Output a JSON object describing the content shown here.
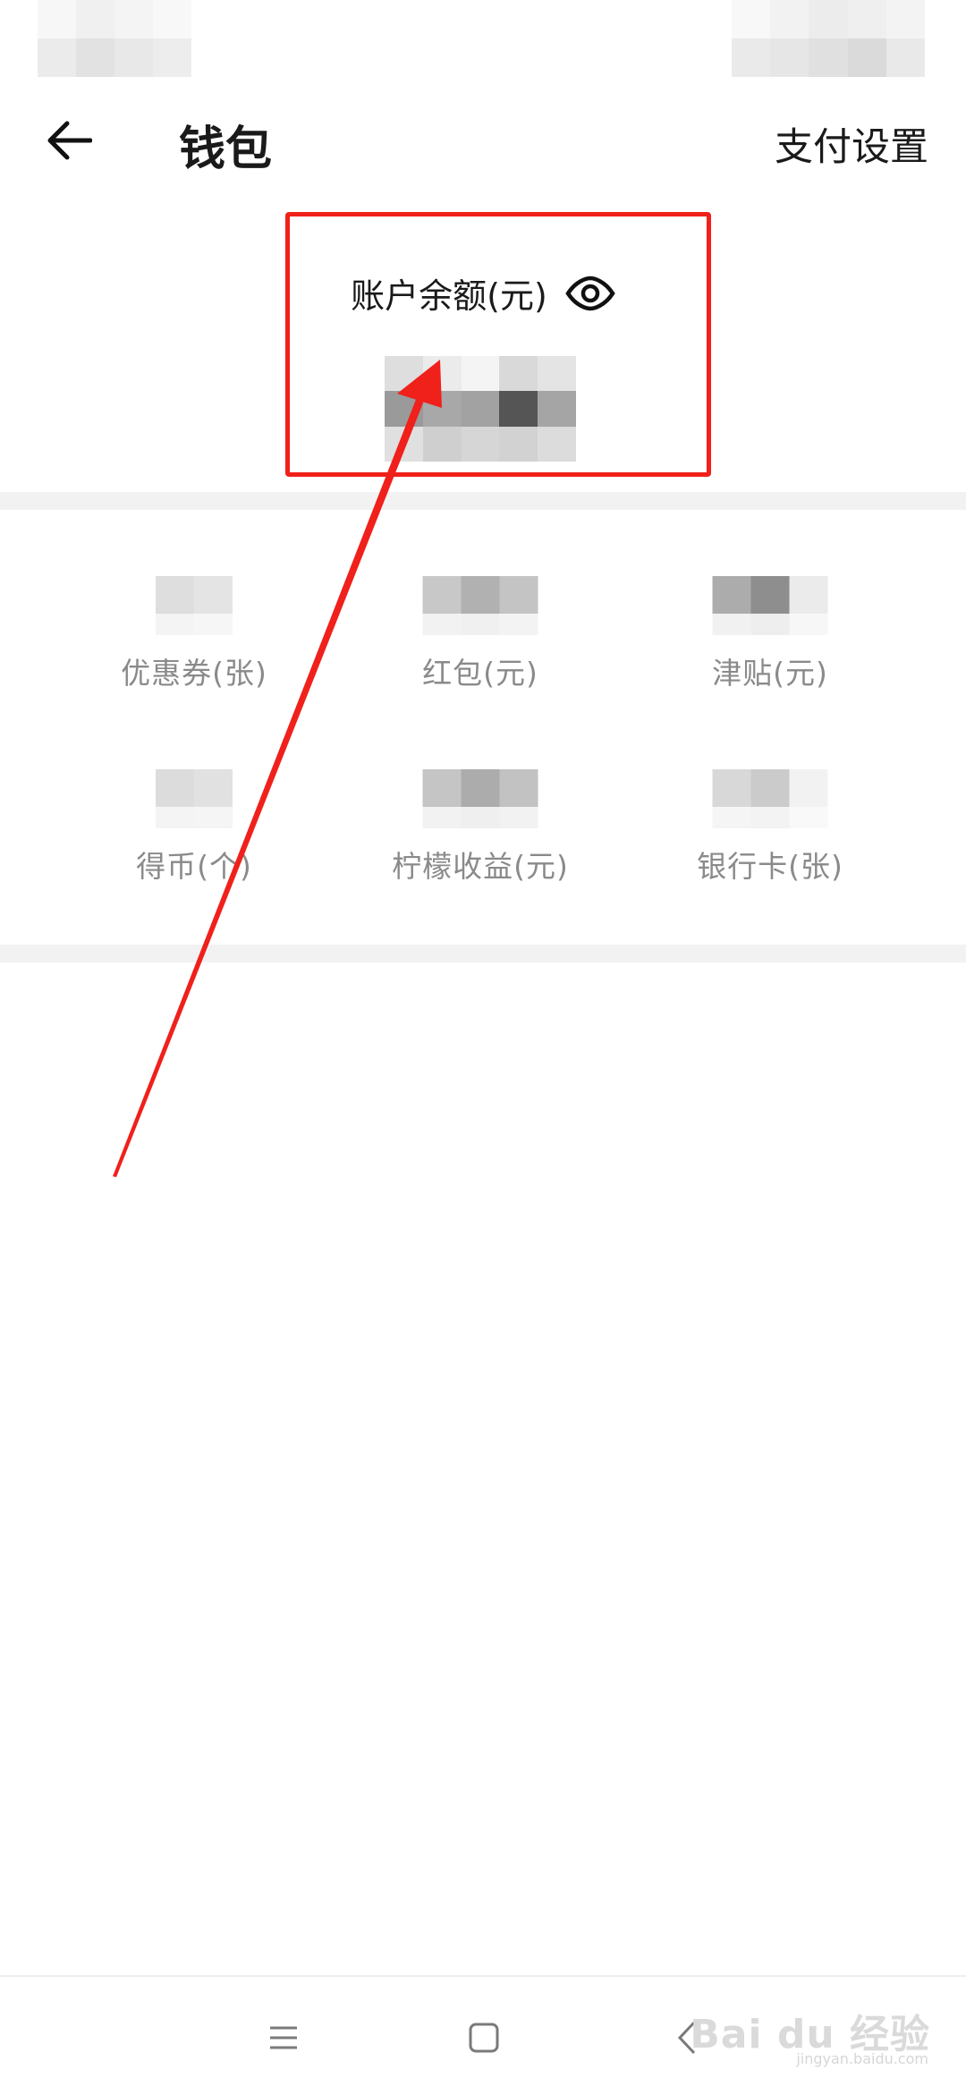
{
  "header": {
    "title": "钱包",
    "pay_settings_label": "支付设置"
  },
  "balance": {
    "label": "账户余额(元)"
  },
  "assets": [
    {
      "label": "优惠券(张)"
    },
    {
      "label": "红包(元)"
    },
    {
      "label": "津贴(元)"
    },
    {
      "label": "得币(个)"
    },
    {
      "label": "柠檬收益(元)"
    },
    {
      "label": "银行卡(张)"
    }
  ],
  "watermark": {
    "brand": "Bai du 经验",
    "url": "jingyan.baidu.com"
  },
  "colors": {
    "annotation_red": "#f0201b",
    "label_gray": "#8a8a8a",
    "divider": "#f2f2f2"
  },
  "icons": {
    "back": "arrow-left-icon",
    "eye": "eye-icon",
    "nav_menu": "menu-icon",
    "nav_home": "home-square-icon",
    "nav_back": "chevron-left-icon"
  }
}
